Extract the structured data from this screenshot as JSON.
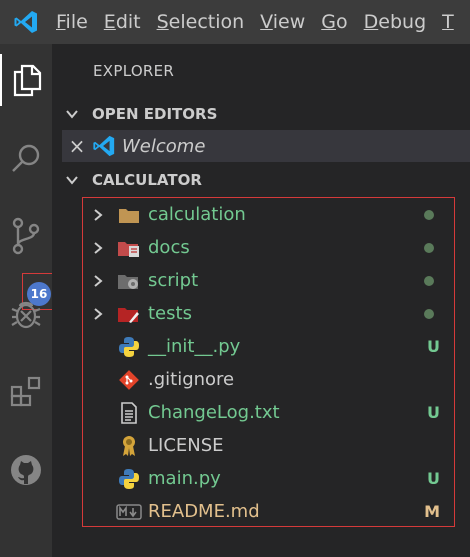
{
  "menubar": {
    "items": [
      {
        "label": "File",
        "mnemonic": "F"
      },
      {
        "label": "Edit",
        "mnemonic": "E"
      },
      {
        "label": "Selection",
        "mnemonic": "S"
      },
      {
        "label": "View",
        "mnemonic": "V"
      },
      {
        "label": "Go",
        "mnemonic": "G"
      },
      {
        "label": "Debug",
        "mnemonic": "D"
      },
      {
        "label": "T",
        "mnemonic": "T"
      }
    ]
  },
  "activitybar": {
    "items": [
      "files-icon",
      "search-icon",
      "source-control-icon",
      "debug-icon",
      "extensions-icon",
      "github-icon"
    ],
    "scm_badge": "16"
  },
  "sidebar": {
    "title": "EXPLORER",
    "open_editors": {
      "header": "OPEN EDITORS",
      "items": [
        {
          "label": "Welcome",
          "icon": "vscode-icon"
        }
      ]
    },
    "project": {
      "header": "CALCULATOR",
      "items": [
        {
          "name": "calculation",
          "type": "folder",
          "icon": "folder-icon",
          "status": "dot",
          "color": "#73c991"
        },
        {
          "name": "docs",
          "type": "folder",
          "icon": "docs-folder-icon",
          "status": "dot",
          "color": "#73c991"
        },
        {
          "name": "script",
          "type": "folder",
          "icon": "script-folder-icon",
          "status": "dot",
          "color": "#73c991"
        },
        {
          "name": "tests",
          "type": "folder",
          "icon": "tests-folder-icon",
          "status": "dot",
          "color": "#73c991"
        },
        {
          "name": "__init__.py",
          "type": "file",
          "icon": "python-icon",
          "status": "U",
          "color": "#73c991"
        },
        {
          "name": ".gitignore",
          "type": "file",
          "icon": "git-icon",
          "status": "",
          "color": "#cccccc"
        },
        {
          "name": "ChangeLog.txt",
          "type": "file",
          "icon": "text-file-icon",
          "status": "U",
          "color": "#73c991"
        },
        {
          "name": "LICENSE",
          "type": "file",
          "icon": "license-icon",
          "status": "",
          "color": "#cccccc"
        },
        {
          "name": "main.py",
          "type": "file",
          "icon": "python-icon",
          "status": "U",
          "color": "#73c991"
        },
        {
          "name": "README.md",
          "type": "file",
          "icon": "markdown-icon",
          "status": "M",
          "color": "#e2c08d"
        }
      ]
    }
  },
  "colors": {
    "accent": "#007acc",
    "untracked": "#73c991",
    "modified": "#e2c08d",
    "highlight_box": "#d53a3a"
  }
}
